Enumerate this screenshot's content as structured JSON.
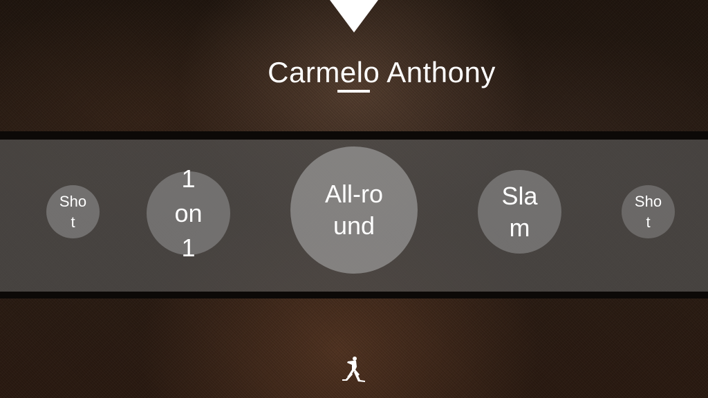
{
  "player": {
    "name": "Carmelo Anthony"
  },
  "skills": [
    {
      "label": "Shot"
    },
    {
      "label": "1 on 1"
    },
    {
      "label": "All-round"
    },
    {
      "label": "Slam"
    },
    {
      "label": "Shot"
    }
  ],
  "icons": {
    "top_pointer": "triangle-down-icon",
    "logo": "jumpman-logo"
  },
  "colors": {
    "text": "#ffffff",
    "band": "#504e4d",
    "bubble": "#969696"
  }
}
